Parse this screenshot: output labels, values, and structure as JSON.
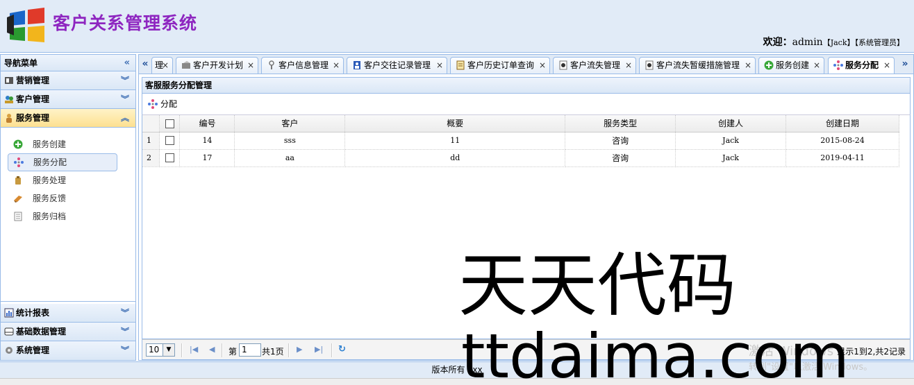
{
  "header": {
    "title": "客户关系管理系统",
    "welcome_prefix": "欢迎：",
    "user": "admin",
    "user_name": "【Jack】",
    "user_role": "【系统管理员】"
  },
  "nav": {
    "title": "导航菜单",
    "sections": [
      {
        "label": "营销管理"
      },
      {
        "label": "客户管理"
      },
      {
        "label": "服务管理"
      },
      {
        "label": "统计报表"
      },
      {
        "label": "基础数据管理"
      },
      {
        "label": "系统管理"
      }
    ],
    "service_items": [
      {
        "label": "服务创建"
      },
      {
        "label": "服务分配"
      },
      {
        "label": "服务处理"
      },
      {
        "label": "服务反馈"
      },
      {
        "label": "服务归档"
      }
    ]
  },
  "tabs": [
    {
      "label": "理"
    },
    {
      "label": "客户开发计划"
    },
    {
      "label": "客户信息管理"
    },
    {
      "label": "客户交往记录管理"
    },
    {
      "label": "客户历史订单查询"
    },
    {
      "label": "客户流失管理"
    },
    {
      "label": "客户流失暂缓措施管理"
    },
    {
      "label": "服务创建"
    },
    {
      "label": "服务分配"
    }
  ],
  "tab_close": "×",
  "panel": {
    "title": "客服服务分配管理",
    "assign_button": "分配"
  },
  "grid": {
    "columns": [
      "编号",
      "客户",
      "概要",
      "服务类型",
      "创建人",
      "创建日期"
    ],
    "rows": [
      {
        "num": "1",
        "id": "14",
        "customer": "sss",
        "summary": "11",
        "type": "咨询",
        "creator": "Jack",
        "date": "2015-08-24"
      },
      {
        "num": "2",
        "id": "17",
        "customer": "aa",
        "summary": "dd",
        "type": "咨询",
        "creator": "Jack",
        "date": "2019-04-11"
      }
    ]
  },
  "pager": {
    "page_size": "10",
    "page_label_pre": "第",
    "page_value": "1",
    "page_label_post": "共1页",
    "info": "显示1到2,共2记录"
  },
  "footer": {
    "text": "版本所有 xxx"
  },
  "watermark": {
    "line1": "天天代码",
    "line2": "ttdaima.com",
    "windows1": "激活 Windows",
    "windows2": "转到\"设置\"以激活 Windows。"
  }
}
